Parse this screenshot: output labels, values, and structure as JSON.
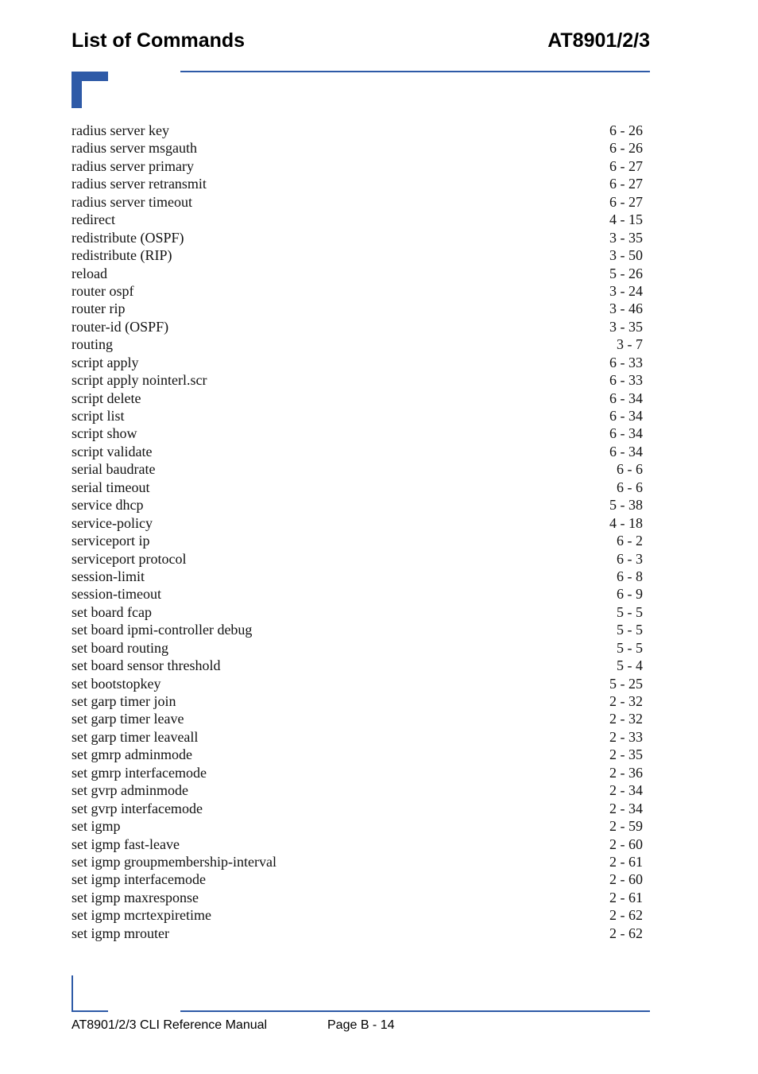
{
  "header": {
    "section_title": "List of Commands",
    "product": "AT8901/2/3"
  },
  "colors": {
    "accent": "#2e5aa7"
  },
  "entries": [
    {
      "command": "radius server key",
      "page": "6 - 26"
    },
    {
      "command": "radius server msgauth",
      "page": "6 - 26"
    },
    {
      "command": "radius server primary",
      "page": "6 - 27"
    },
    {
      "command": "radius server retransmit",
      "page": "6 - 27"
    },
    {
      "command": "radius server timeout",
      "page": "6 - 27"
    },
    {
      "command": "redirect",
      "page": "4 - 15"
    },
    {
      "command": "redistribute (OSPF)",
      "page": "3 - 35"
    },
    {
      "command": "redistribute (RIP)",
      "page": "3 - 50"
    },
    {
      "command": "reload",
      "page": "5 - 26"
    },
    {
      "command": "router ospf",
      "page": "3 - 24"
    },
    {
      "command": "router rip",
      "page": "3 - 46"
    },
    {
      "command": "router-id (OSPF)",
      "page": "3 - 35"
    },
    {
      "command": "routing",
      "page": "3 - 7"
    },
    {
      "command": "script apply",
      "page": "6 - 33"
    },
    {
      "command": "script apply nointerl.scr",
      "page": "6 - 33"
    },
    {
      "command": "script delete",
      "page": "6 - 34"
    },
    {
      "command": "script list",
      "page": "6 - 34"
    },
    {
      "command": "script show",
      "page": "6 - 34"
    },
    {
      "command": "script validate",
      "page": "6 - 34"
    },
    {
      "command": "serial baudrate",
      "page": "6 - 6"
    },
    {
      "command": "serial timeout",
      "page": "6 - 6"
    },
    {
      "command": "service dhcp",
      "page": "5 - 38"
    },
    {
      "command": "service-policy",
      "page": "4 - 18"
    },
    {
      "command": "serviceport ip",
      "page": "6 - 2"
    },
    {
      "command": "serviceport protocol",
      "page": "6 - 3"
    },
    {
      "command": "session-limit",
      "page": "6 - 8"
    },
    {
      "command": "session-timeout",
      "page": "6 - 9"
    },
    {
      "command": "set board fcap",
      "page": "5 - 5"
    },
    {
      "command": "set board ipmi-controller debug",
      "page": "5 - 5"
    },
    {
      "command": "set board routing",
      "page": "5 - 5"
    },
    {
      "command": "set board sensor threshold",
      "page": "5 - 4"
    },
    {
      "command": "set bootstopkey",
      "page": "5 - 25"
    },
    {
      "command": "set garp timer join",
      "page": "2 - 32"
    },
    {
      "command": "set garp timer leave",
      "page": "2 - 32"
    },
    {
      "command": "set garp timer leaveall",
      "page": "2 - 33"
    },
    {
      "command": "set gmrp adminmode",
      "page": "2 - 35"
    },
    {
      "command": "set gmrp interfacemode",
      "page": "2 - 36"
    },
    {
      "command": "set gvrp adminmode",
      "page": "2 - 34"
    },
    {
      "command": "set gvrp interfacemode",
      "page": "2 - 34"
    },
    {
      "command": "set igmp",
      "page": "2 - 59"
    },
    {
      "command": "set igmp fast-leave",
      "page": "2 - 60"
    },
    {
      "command": "set igmp groupmembership-interval",
      "page": "2 - 61"
    },
    {
      "command": "set igmp interfacemode",
      "page": "2 - 60"
    },
    {
      "command": "set igmp maxresponse",
      "page": "2 - 61"
    },
    {
      "command": "set igmp mcrtexpiretime",
      "page": "2 - 62"
    },
    {
      "command": "set igmp mrouter",
      "page": "2 - 62"
    }
  ],
  "footer": {
    "manual_title": "AT8901/2/3 CLI Reference Manual",
    "page_number": "Page B - 14"
  }
}
